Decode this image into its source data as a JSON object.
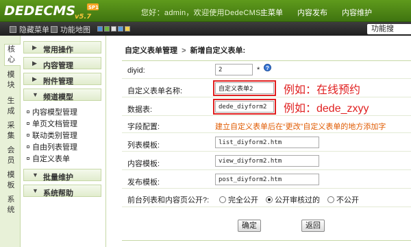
{
  "app": {
    "logo_text": "DEDECMS",
    "version": "v5.7",
    "badge": "SP1",
    "welcome": "您好：admin，欢迎使用DedeCMS!",
    "topnav": [
      "主菜单",
      "内容发布",
      "内容维护"
    ]
  },
  "toolbar": {
    "hide_menu": "隐藏菜单",
    "func_map": "功能地图",
    "func_search": "功能搜"
  },
  "vtabs": [
    "核心",
    "模块",
    "生成",
    "采集",
    "会员",
    "模板",
    "系统"
  ],
  "sidebar": {
    "groups": [
      {
        "label": "常用操作",
        "arrow": "▶"
      },
      {
        "label": "内容管理",
        "arrow": "▶"
      },
      {
        "label": "附件管理",
        "arrow": "▶"
      },
      {
        "label": "频道模型",
        "arrow": "▼"
      }
    ],
    "channel_items": [
      "内容模型管理",
      "单页文档管理",
      "联动类别管理",
      "自由列表管理",
      "自定义表单"
    ],
    "bottom_groups": [
      {
        "label": "批量维护",
        "arrow": "▼"
      },
      {
        "label": "系统帮助",
        "arrow": "▼"
      }
    ]
  },
  "main": {
    "breadcrumb_parent": "自定义表单管理",
    "breadcrumb_sep": ">",
    "breadcrumb_current": "新增自定义表单:",
    "form": {
      "diyid_label": "diyid:",
      "diyid_value": "2",
      "name_label": "自定义表单名称:",
      "name_value": "自定义表单2",
      "name_annotation": "例如：在线预约",
      "table_label": "数据表:",
      "table_value": "dede_diyform2",
      "table_annotation": "例如：dede_zxyy",
      "fields_label": "字段配置:",
      "fields_note": "建立自定义表单后在“更改”自定义表单的地方添加字",
      "list_tpl_label": "列表模板:",
      "list_tpl_value": "list_diyform2.htm",
      "view_tpl_label": "内容模板:",
      "view_tpl_value": "view_diyform2.htm",
      "post_tpl_label": "发布模板:",
      "post_tpl_value": "post_diyform2.htm",
      "public_label": "前台列表和内容页公开?:",
      "public_options": [
        "完全公开",
        "公开审核过的",
        "不公开"
      ],
      "public_selected": "公开审核过的",
      "star": "*",
      "help_glyph": "?"
    },
    "ok_button": "确定",
    "back_button": "返回"
  },
  "colors": {
    "header_green": "#4f8a17",
    "highlight_red": "#e02020",
    "note_orange": "#e05a00",
    "sidebar_bg": "#e8f1d8"
  }
}
